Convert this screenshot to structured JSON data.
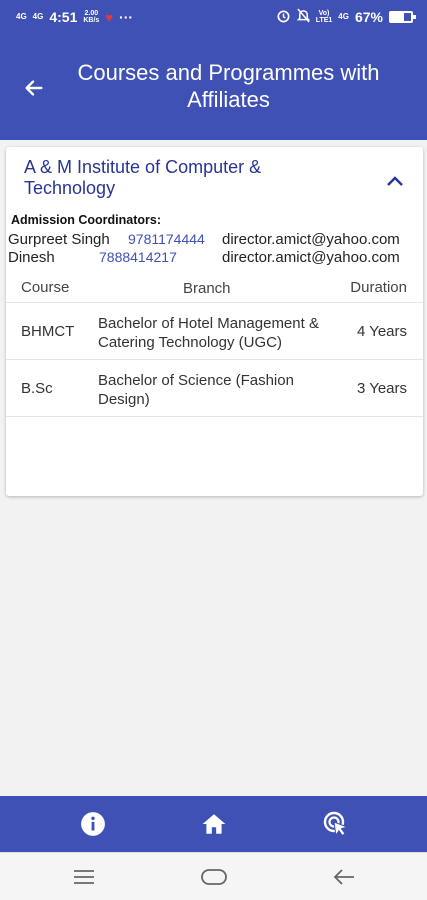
{
  "status_bar": {
    "net1": "4G",
    "net2": "4G",
    "time": "4:51",
    "speed_value": "2.00",
    "speed_unit": "KB/s",
    "more": "···",
    "volte_top": "Vo)",
    "volte_bottom": "LTE1",
    "net3": "4G",
    "battery_text": "67%",
    "battery_level": 0.67
  },
  "app_bar": {
    "title": "Courses and Programmes with Affiliates"
  },
  "institute": {
    "name": "A & M Institute of Computer & Technology",
    "coordinators_label": "Admission Coordinators:",
    "coordinators": [
      {
        "name": "Gurpreet Singh",
        "phone": "9781174444",
        "email": "director.amict@yahoo.com"
      },
      {
        "name": "Dinesh",
        "phone": "7888414217",
        "email": "director.amict@yahoo.com"
      }
    ],
    "table": {
      "headers": {
        "course": "Course",
        "branch": "Branch",
        "duration": "Duration"
      },
      "rows": [
        {
          "course": "BHMCT",
          "branch": "Bachelor of Hotel Management & Catering Technology (UGC)",
          "duration": "4 Years"
        },
        {
          "course": "B.Sc",
          "branch": "Bachelor of Science (Fashion Design)",
          "duration": "3 Years"
        }
      ]
    }
  },
  "bottom_nav": [
    "info-icon",
    "home-icon",
    "touch-icon"
  ],
  "colors": {
    "primary": "#3f51b5",
    "title_text": "#283593",
    "link": "#3f51b5"
  }
}
